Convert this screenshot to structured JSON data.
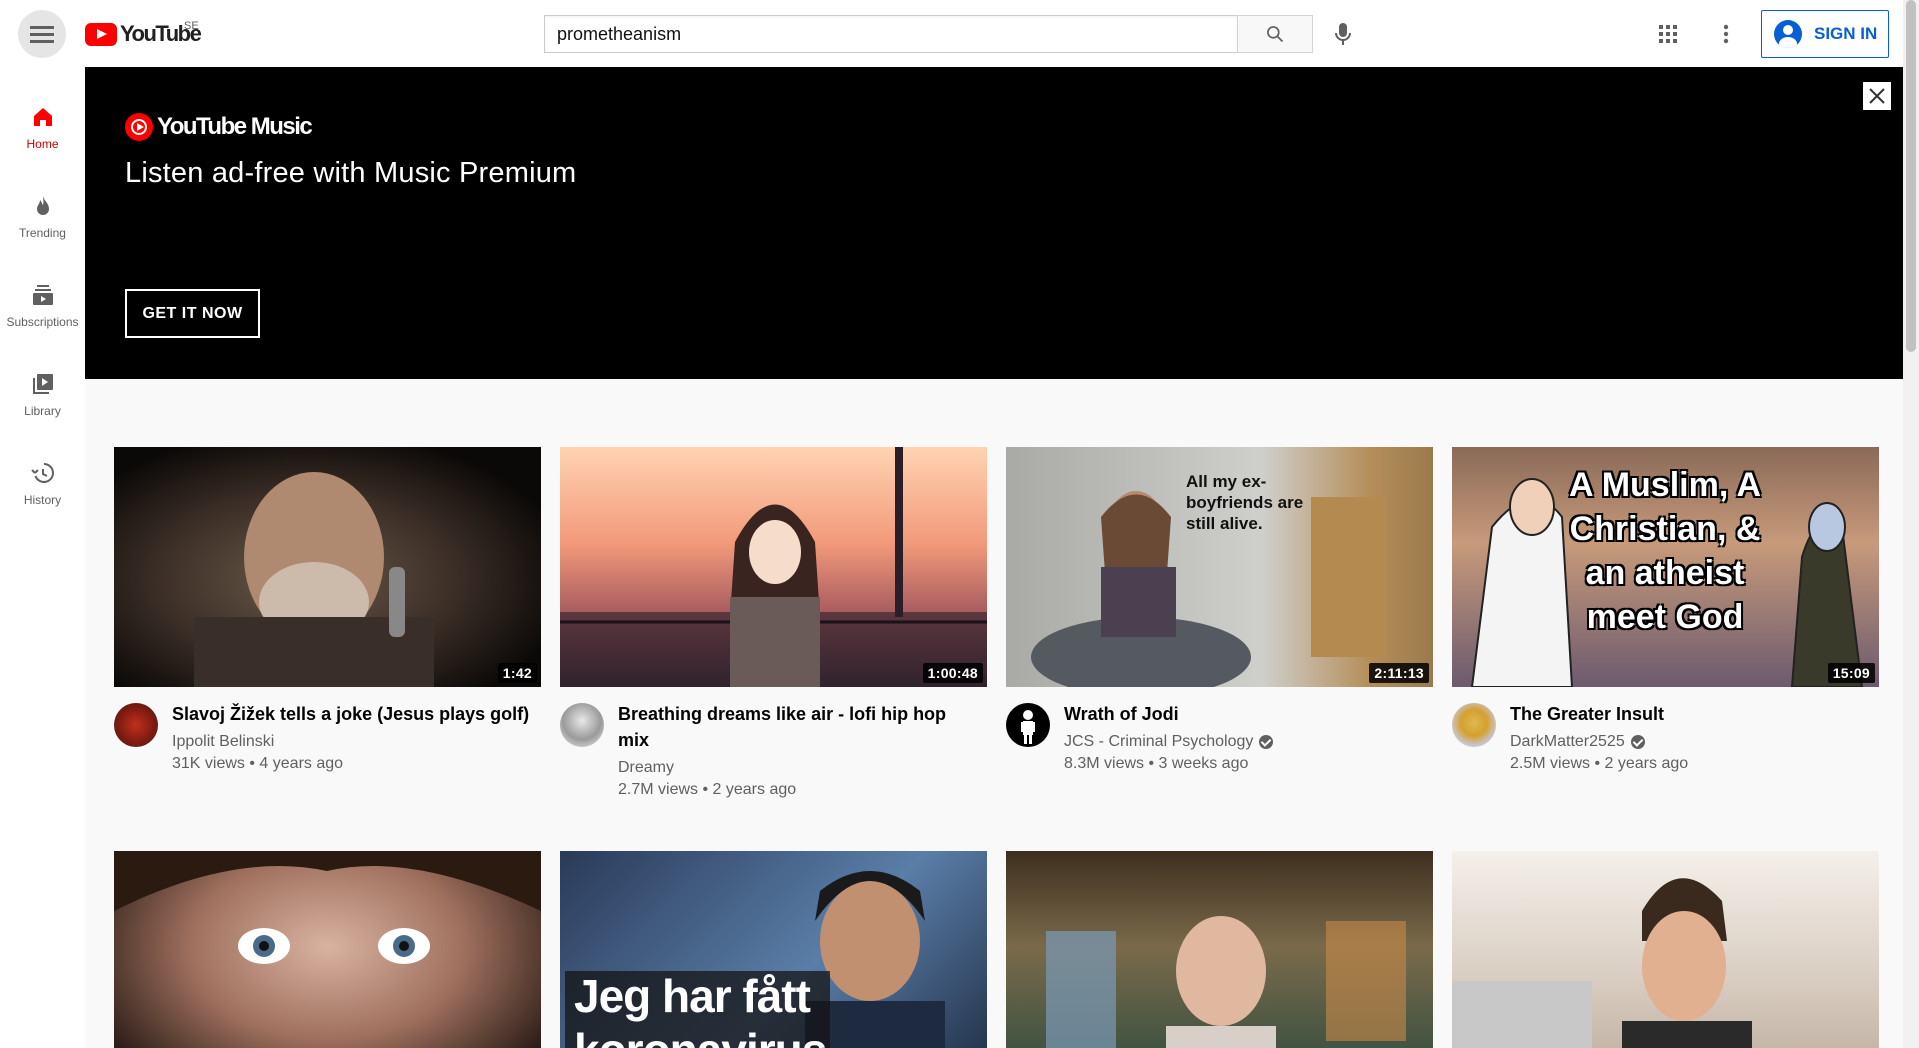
{
  "header": {
    "logo_text": "YouTube",
    "country_code": "SE",
    "search_value": "prometheanism",
    "search_placeholder": "Search",
    "sign_in_label": "SIGN IN"
  },
  "sidebar": {
    "items": [
      {
        "label": "Home",
        "icon": "home-icon",
        "active": true
      },
      {
        "label": "Trending",
        "icon": "flame-icon",
        "active": false
      },
      {
        "label": "Subscriptions",
        "icon": "subscriptions-icon",
        "active": false
      },
      {
        "label": "Library",
        "icon": "library-icon",
        "active": false
      },
      {
        "label": "History",
        "icon": "history-icon",
        "active": false
      }
    ]
  },
  "banner": {
    "logo_text": "YouTube Music",
    "headline": "Listen ad-free with Music Premium",
    "cta_label": "GET IT NOW"
  },
  "videos": [
    {
      "title": "Slavoj Žižek tells a joke (Jesus plays golf)",
      "channel": "Ippolit Belinski",
      "verified": false,
      "views": "31K views",
      "age": "4 years ago",
      "duration": "1:42"
    },
    {
      "title": "Breathing dreams like air - lofi hip hop mix",
      "channel": "Dreamy",
      "verified": false,
      "views": "2.7M views",
      "age": "2 years ago",
      "duration": "1:00:48"
    },
    {
      "title": "Wrath of Jodi",
      "channel": "JCS - Criminal Psychology",
      "verified": true,
      "views": "8.3M views",
      "age": "3 weeks ago",
      "duration": "2:11:13"
    },
    {
      "title": "The Greater Insult",
      "channel": "DarkMatter2525",
      "verified": true,
      "views": "2.5M views",
      "age": "2 years ago",
      "duration": "15:09"
    }
  ],
  "thumb_text": {
    "t3": "All my ex-boyfriends are still alive.",
    "t4": "A Muslim, A Christian, & an atheist meet God",
    "t6": "Jeg har fått koronavirus"
  },
  "colors": {
    "brand_red": "#ff0000",
    "link_blue": "#065fd4",
    "text_secondary": "#606060",
    "active_red": "#cc0000"
  }
}
